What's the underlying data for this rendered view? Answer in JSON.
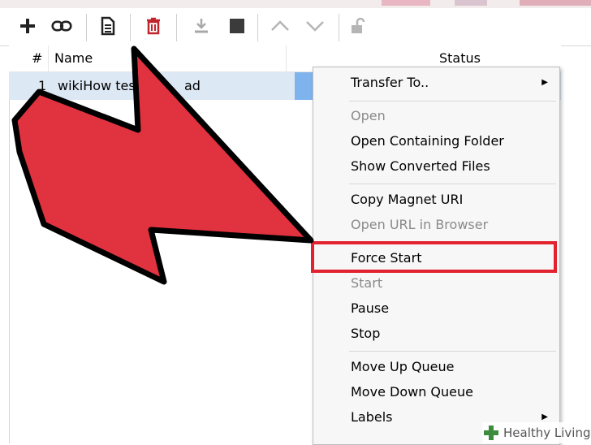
{
  "toolbar": {
    "buttons": [
      {
        "name": "add-torrent-button",
        "icon": "plus-icon"
      },
      {
        "name": "add-link-button",
        "icon": "link-icon"
      },
      {
        "name": "create-torrent-button",
        "icon": "document-icon"
      },
      {
        "name": "remove-button",
        "icon": "trash-icon"
      },
      {
        "name": "start-button",
        "icon": "download-icon"
      },
      {
        "name": "stop-button",
        "icon": "stop-icon"
      },
      {
        "name": "move-up-button",
        "icon": "chevron-up-icon"
      },
      {
        "name": "move-down-button",
        "icon": "chevron-down-icon"
      },
      {
        "name": "unlock-button",
        "icon": "unlock-icon"
      }
    ]
  },
  "table": {
    "columns": {
      "index": "#",
      "name": "Name",
      "status": "Status"
    },
    "rows": [
      {
        "index": "1",
        "name": "wikiHow tes",
        "name_tail": "ad"
      }
    ]
  },
  "context_menu": {
    "items": [
      {
        "label": "Transfer To..",
        "enabled": true,
        "submenu": true
      },
      {
        "label": "Open",
        "enabled": false
      },
      {
        "label": "Open Containing Folder",
        "enabled": true
      },
      {
        "label": "Show Converted Files",
        "enabled": true
      },
      {
        "label": "Copy Magnet URI",
        "enabled": true
      },
      {
        "label": "Open URL in Browser",
        "enabled": false
      },
      {
        "label": "Force Start",
        "enabled": true,
        "highlighted": true
      },
      {
        "label": "Start",
        "enabled": false
      },
      {
        "label": "Pause",
        "enabled": true
      },
      {
        "label": "Stop",
        "enabled": true
      },
      {
        "label": "Move Up Queue",
        "enabled": true
      },
      {
        "label": "Move Down Queue",
        "enabled": true
      },
      {
        "label": "Labels",
        "enabled": true,
        "submenu": true
      }
    ]
  },
  "watermark": {
    "text": "Healthy Living"
  },
  "colors": {
    "highlight_border": "#e3222f",
    "arrow_fill": "#e1323f",
    "row_selected": "#dde8f5",
    "progress": "#7fb3ee",
    "menu_hover": "#cde0f5"
  }
}
